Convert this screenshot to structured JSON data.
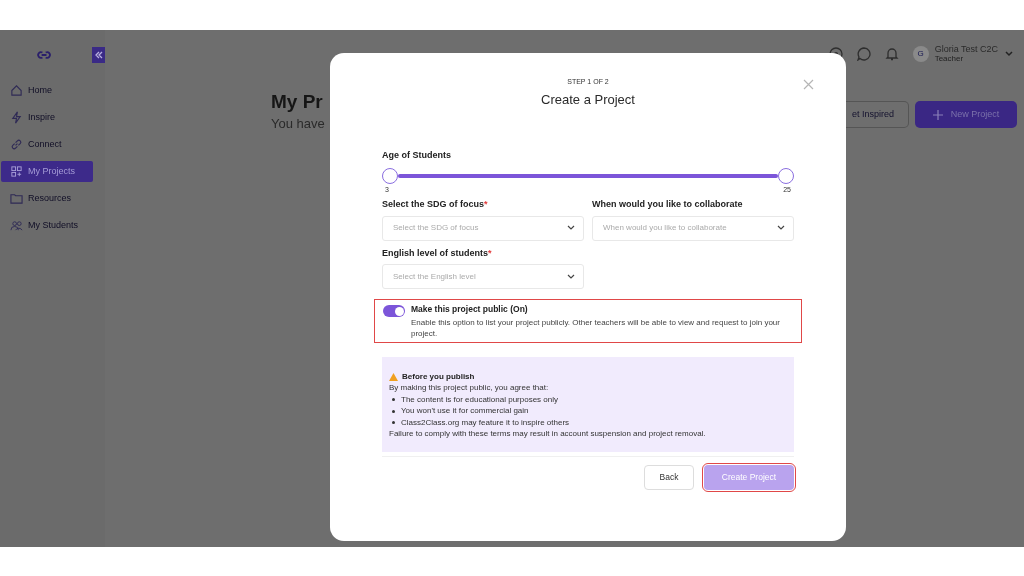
{
  "sidebar": {
    "items": [
      {
        "label": "Home",
        "selected": false
      },
      {
        "label": "Inspire",
        "selected": false
      },
      {
        "label": "Connect",
        "selected": false
      },
      {
        "label": "My Projects",
        "selected": true
      },
      {
        "label": "Resources",
        "selected": false
      },
      {
        "label": "My Students",
        "selected": false
      }
    ]
  },
  "header": {
    "user": {
      "initial": "G",
      "name": "Gloria Test C2C",
      "role": "Teacher"
    }
  },
  "page": {
    "title": "My Pr",
    "subtitle": "You have",
    "buttons": [
      {
        "label": "et Inspired",
        "kind": "outline"
      },
      {
        "label": "New Project",
        "kind": "primary"
      }
    ]
  },
  "modal": {
    "step": "STEP 1 OF 2",
    "title": "Create a Project",
    "age": {
      "label": "Age of Students",
      "min_label": "3",
      "max_label": "25",
      "level": 1
    },
    "fields": [
      {
        "label": "Select the SDG of focus",
        "required_mark": "*",
        "placeholder": "Select the SDG of focus"
      },
      {
        "label": "When would you like to collaborate",
        "placeholder": "When would you like to collaborate"
      },
      {
        "label": "English level of students",
        "required_mark": "*",
        "placeholder": "Select the English level"
      }
    ],
    "public": {
      "on": true,
      "highlighted": true,
      "title": "Make this project public (On)",
      "description": "Enable this option to list your project publicly. Other teachers will be able to view and request to join your project."
    },
    "notice": {
      "title": "Before you publish",
      "intro": "By making this project public, you agree that:",
      "bullets": [
        "The content is for educational purposes only",
        "You won't use it for commercial gain",
        "Class2Class.org may feature it to inspire others"
      ],
      "footer": "Failure to comply with these terms may result in account suspension and project removal."
    },
    "buttons": [
      {
        "label": "Back",
        "kind": "secondary",
        "disabled": false,
        "highlighted": false
      },
      {
        "label": "Create Project",
        "kind": "primary",
        "disabled": true,
        "highlighted": true
      }
    ]
  }
}
